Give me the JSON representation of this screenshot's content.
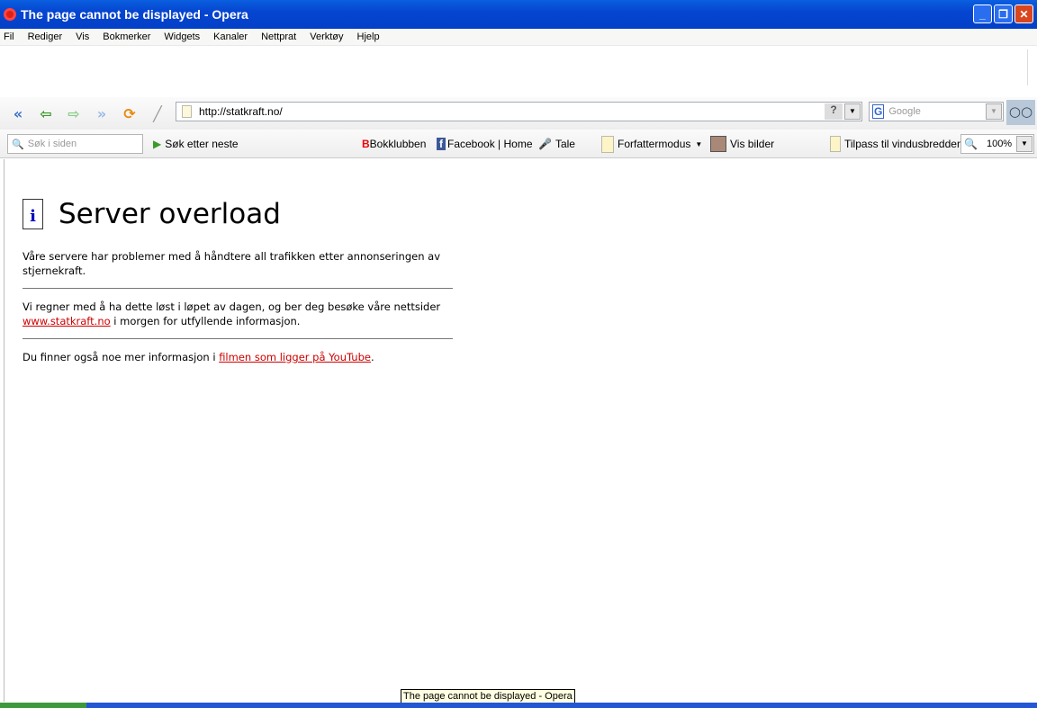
{
  "window": {
    "title": "The page cannot be displayed - Opera"
  },
  "menu": [
    "Fil",
    "Rediger",
    "Vis",
    "Bokmerker",
    "Widgets",
    "Kanaler",
    "Nettprat",
    "Verktøy",
    "Hjelp"
  ],
  "address": {
    "url": "http://statkraft.no/",
    "help": "?"
  },
  "search": {
    "placeholder": "Google",
    "engine_icon": "G"
  },
  "toolbar2": {
    "find_placeholder": "Søk i siden",
    "find_next": "Søk etter neste",
    "bokklubben": "Bokklubben",
    "facebook": "Facebook | Home",
    "tale": "Tale",
    "forfattermodus": "Forfattermodus",
    "vis_bilder": "Vis bilder",
    "tilpass": "Tilpass til vindusbredden",
    "zoom": "100%"
  },
  "page": {
    "heading": "Server overload",
    "p1": "Våre servere har problemer med å håndtere all trafikken etter annonseringen av stjernekraft.",
    "p2_before": "Vi regner med å ha dette løst i løpet av dagen, og ber deg besøke våre nettsider ",
    "p2_link": "www.statkraft.no",
    "p2_after": " i morgen for utfyllende informasjon.",
    "p3_before": "Du finner også noe mer informasjon i ",
    "p3_link": "filmen som ligger på YouTube",
    "p3_after": "."
  },
  "tooltip": "The page cannot be displayed - Opera"
}
